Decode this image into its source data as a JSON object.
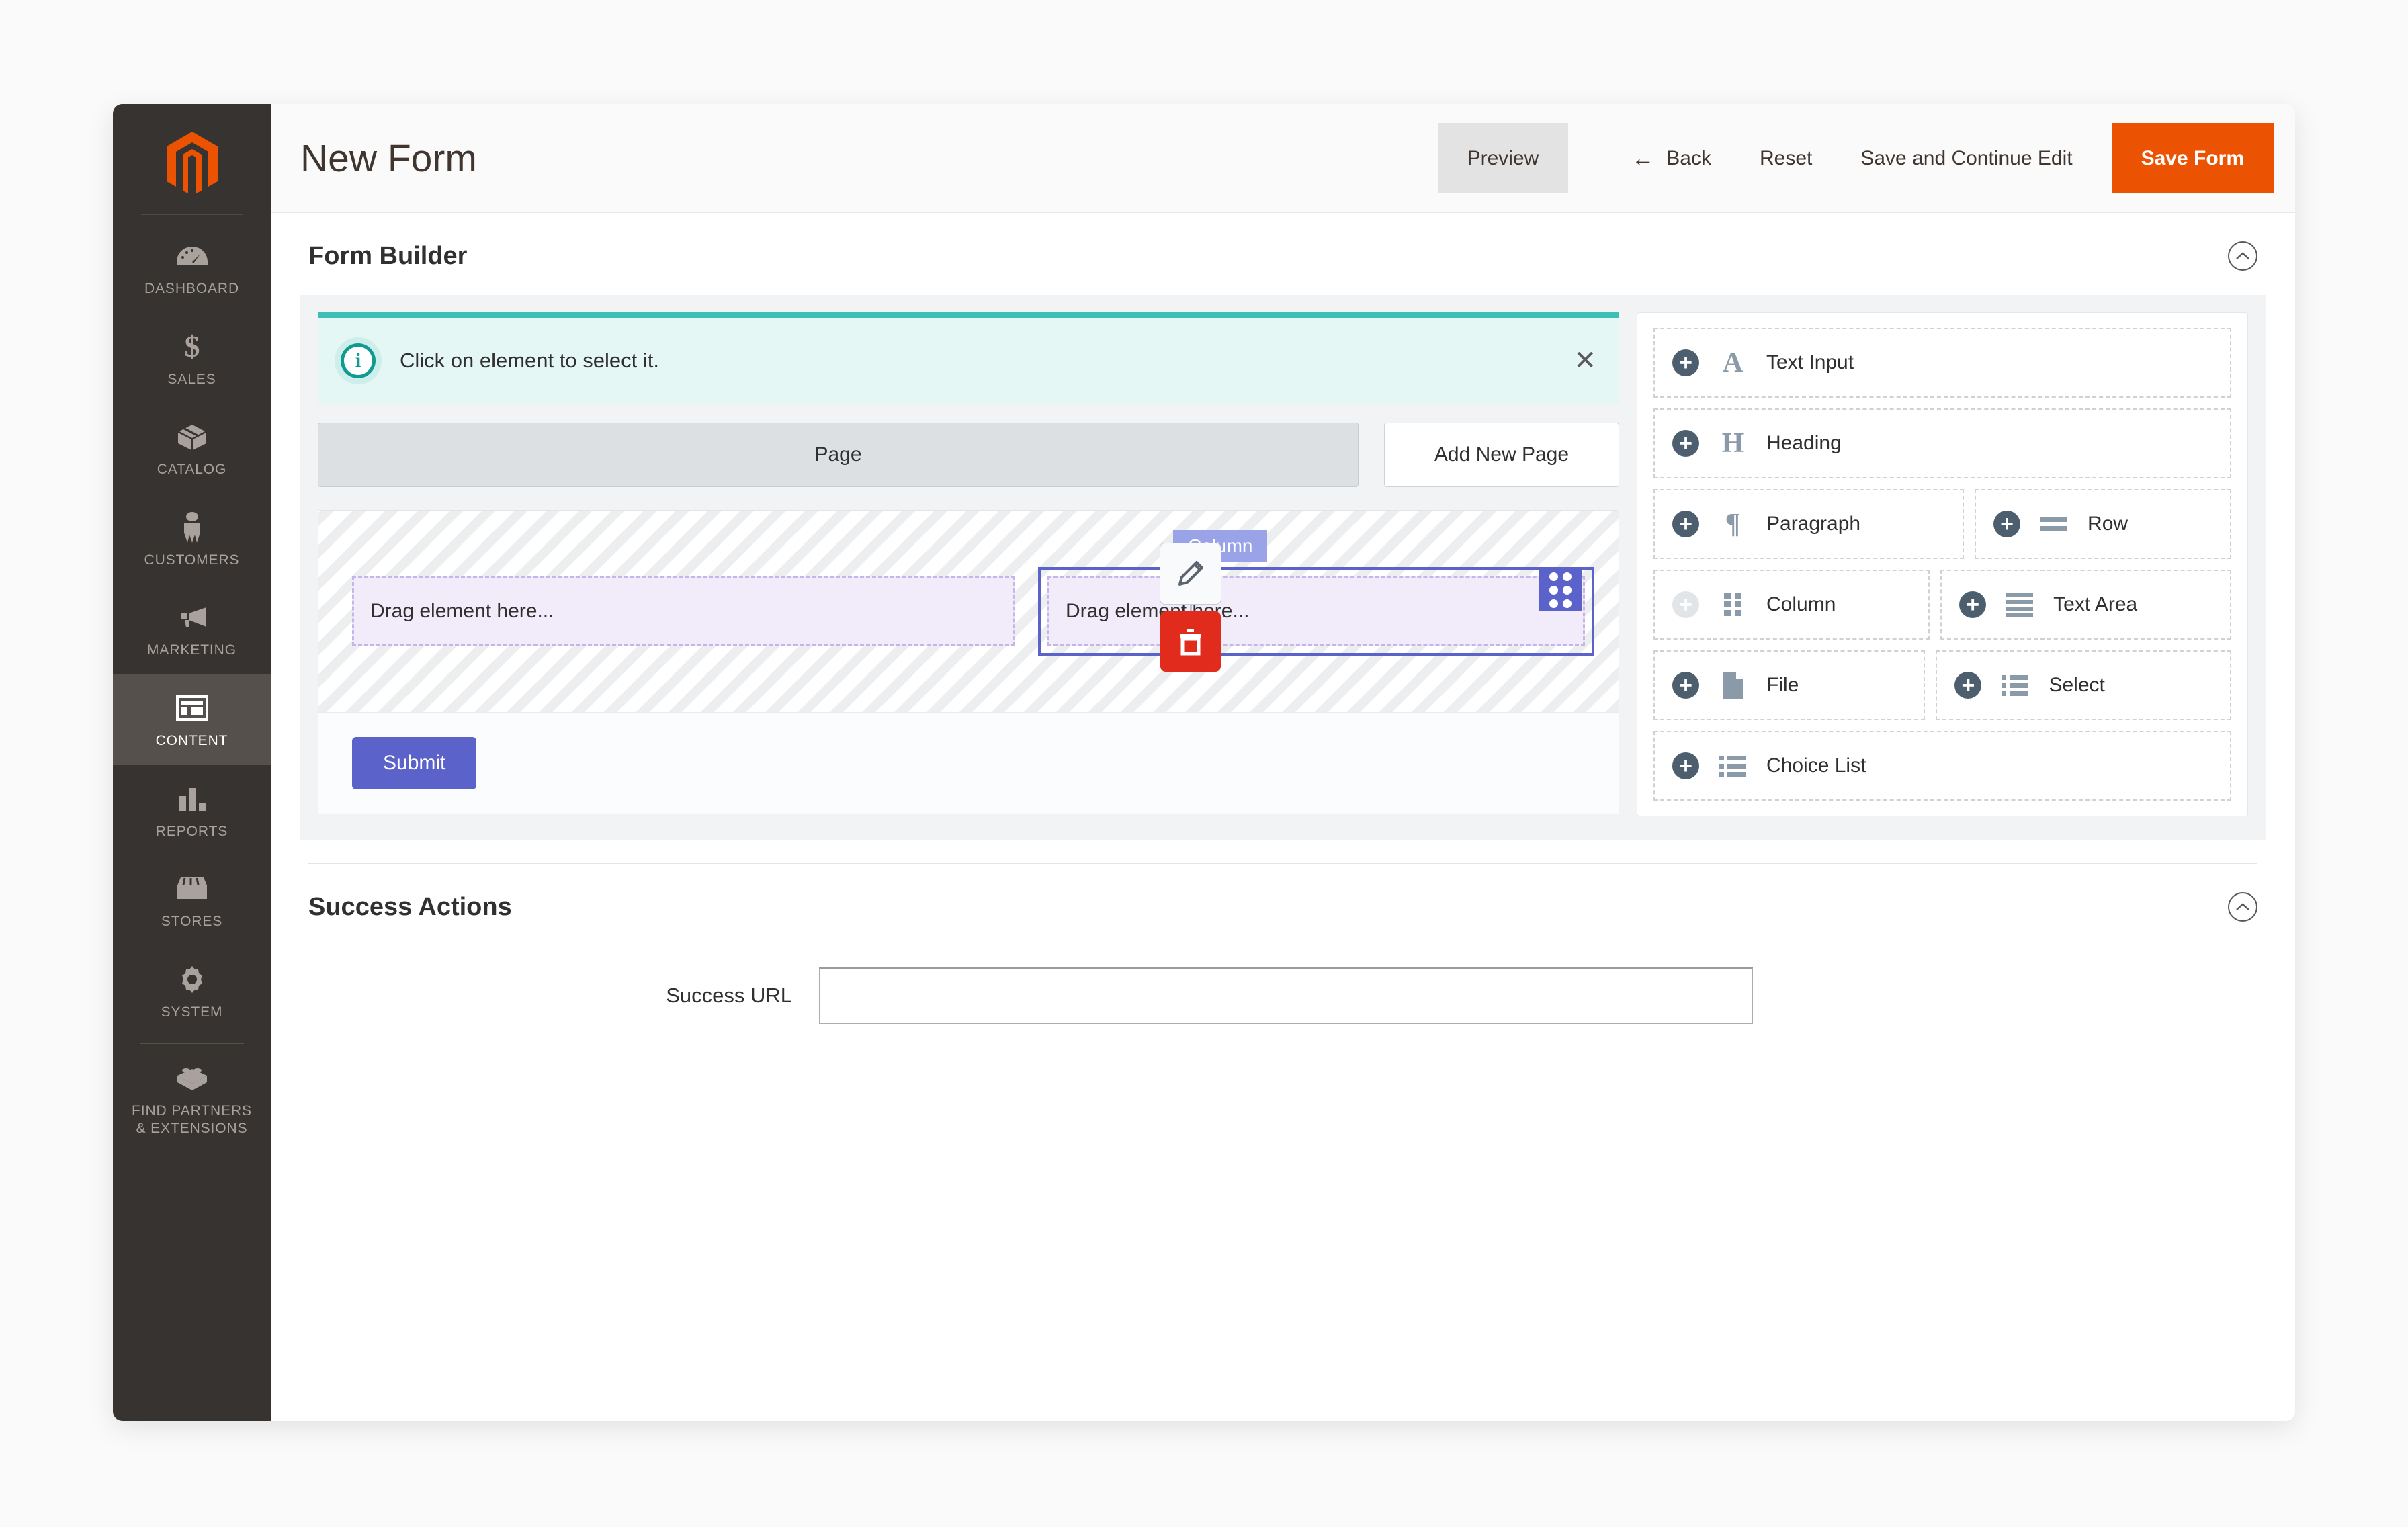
{
  "sidebar": {
    "logo_name": "magento-logo",
    "items": [
      {
        "label": "DASHBOARD",
        "icon": "dashboard-gauge-icon",
        "active": false
      },
      {
        "label": "SALES",
        "icon": "dollar-sign-icon",
        "active": false
      },
      {
        "label": "CATALOG",
        "icon": "box-icon",
        "active": false
      },
      {
        "label": "CUSTOMERS",
        "icon": "person-icon",
        "active": false
      },
      {
        "label": "MARKETING",
        "icon": "megaphone-icon",
        "active": false
      },
      {
        "label": "CONTENT",
        "icon": "layout-icon",
        "active": true
      },
      {
        "label": "REPORTS",
        "icon": "bar-chart-icon",
        "active": false
      },
      {
        "label": "STORES",
        "icon": "storefront-icon",
        "active": false
      },
      {
        "label": "SYSTEM",
        "icon": "gear-icon",
        "active": false
      },
      {
        "label": "FIND PARTNERS\n& EXTENSIONS",
        "icon": "puzzle-brick-icon",
        "active": false
      }
    ]
  },
  "header": {
    "title": "New Form",
    "preview_label": "Preview",
    "back_label": "Back",
    "reset_label": "Reset",
    "save_continue_label": "Save and Continue Edit",
    "save_form_label": "Save Form",
    "save_form_color": "#eb5202"
  },
  "form_builder": {
    "section_title": "Form Builder",
    "notice": {
      "text": "Click on element to select it.",
      "icon": "info-circle-icon",
      "close_icon": "close-icon",
      "accent_color": "#3dbfb5",
      "background_color": "#e5f7f5"
    },
    "page_tab_label": "Page",
    "add_page_label": "Add New Page",
    "columns": [
      {
        "placeholder": "Drag element here...",
        "selected": false
      },
      {
        "placeholder": "Drag element here...",
        "selected": true
      }
    ],
    "selected_badge": "Column",
    "edit_icon": "pencil-icon",
    "delete_icon": "trash-icon",
    "drag_handle_icon": "drag-dots-icon",
    "submit_label": "Submit",
    "submit_color": "#5b63ca",
    "selection_color": "#5b63ca"
  },
  "palette": {
    "rows": [
      [
        {
          "label": "Text Input",
          "icon": "letter-a-icon",
          "glyph": "A",
          "disabled": false
        }
      ],
      [
        {
          "label": "Heading",
          "icon": "letter-h-icon",
          "glyph": "H",
          "disabled": false
        }
      ],
      [
        {
          "label": "Paragraph",
          "icon": "pilcrow-icon",
          "glyph": "¶",
          "disabled": false
        },
        {
          "label": "Row",
          "icon": "row-lines-icon",
          "glyph": "",
          "disabled": false
        }
      ],
      [
        {
          "label": "Column",
          "icon": "column-dots-icon",
          "glyph": "",
          "disabled": true
        },
        {
          "label": "Text Area",
          "icon": "text-area-lines-icon",
          "glyph": "",
          "disabled": false
        }
      ],
      [
        {
          "label": "File",
          "icon": "file-icon",
          "glyph": "",
          "disabled": false
        },
        {
          "label": "Select",
          "icon": "select-list-icon",
          "glyph": "",
          "disabled": false
        }
      ],
      [
        {
          "label": "Choice List",
          "icon": "choice-list-icon",
          "glyph": "",
          "disabled": false
        }
      ]
    ]
  },
  "success_actions": {
    "section_title": "Success Actions",
    "url_label": "Success URL",
    "url_value": "",
    "url_placeholder": ""
  }
}
